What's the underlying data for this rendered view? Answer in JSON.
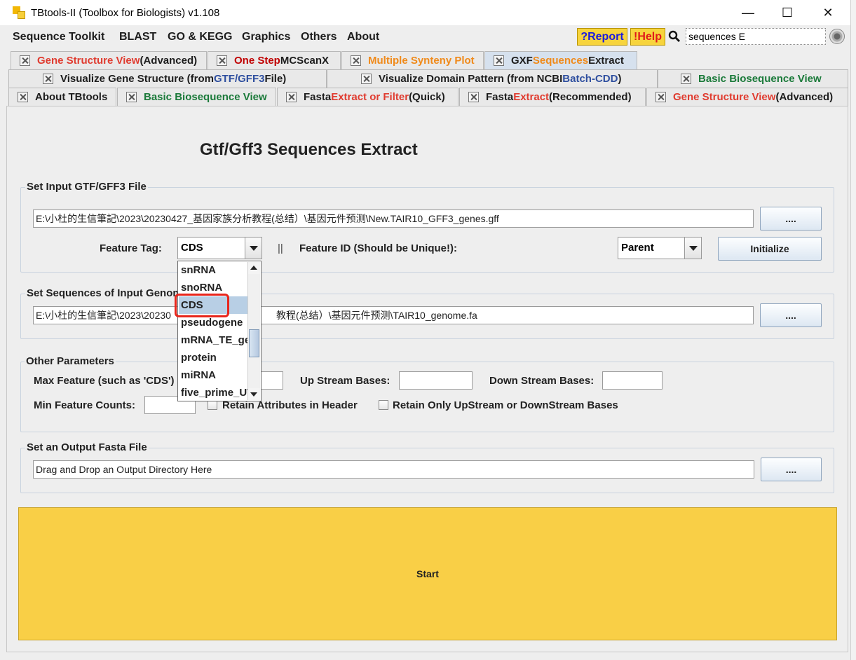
{
  "window": {
    "title": "TBtools-II (Toolbox for Biologists) v1.108",
    "controls": {
      "minimize": "—",
      "maximize": "☐",
      "close": "✕"
    }
  },
  "menu": {
    "items": [
      "Sequence Toolkit",
      "BLAST",
      "GO & KEGG",
      "Graphics",
      "Others",
      "About"
    ],
    "report": "?Report",
    "help": "!Help",
    "search_value": "sequences E"
  },
  "tabs": {
    "row1": [
      {
        "parts": [
          {
            "t": "Gene Structure View",
            "c": "red"
          },
          {
            "t": " (Advanced)",
            "c": "black"
          }
        ]
      },
      {
        "parts": [
          {
            "t": "One Step ",
            "c": "dred"
          },
          {
            "t": "MCScanX",
            "c": "black"
          }
        ]
      },
      {
        "parts": [
          {
            "t": "Multiple Synteny Plot",
            "c": "orange"
          }
        ]
      },
      {
        "parts": [
          {
            "t": "GXF ",
            "c": "black"
          },
          {
            "t": "Sequences",
            "c": "orange"
          },
          {
            "t": " Extract",
            "c": "black"
          }
        ]
      }
    ],
    "row2": [
      {
        "parts": [
          {
            "t": "Visualize Gene Structure (from ",
            "c": "black"
          },
          {
            "t": "GTF/GFF3",
            "c": "blue"
          },
          {
            "t": " File)",
            "c": "black"
          }
        ]
      },
      {
        "parts": [
          {
            "t": "Visualize Domain Pattern (from NCBI ",
            "c": "black"
          },
          {
            "t": "Batch-CDD",
            "c": "blue"
          },
          {
            "t": ")",
            "c": "black"
          }
        ]
      },
      {
        "parts": [
          {
            "t": "Basic Biosequence View",
            "c": "green"
          }
        ]
      }
    ],
    "row3": [
      {
        "parts": [
          {
            "t": "About TBtools",
            "c": "black"
          }
        ]
      },
      {
        "parts": [
          {
            "t": "Basic Biosequence View",
            "c": "green"
          }
        ]
      },
      {
        "parts": [
          {
            "t": "Fasta ",
            "c": "black"
          },
          {
            "t": "Extract or Filter",
            "c": "red"
          },
          {
            "t": " (Quick)",
            "c": "black"
          }
        ]
      },
      {
        "parts": [
          {
            "t": "Fasta ",
            "c": "black"
          },
          {
            "t": "Extract",
            "c": "red"
          },
          {
            "t": " (Recommended)",
            "c": "black"
          }
        ]
      },
      {
        "parts": [
          {
            "t": "Gene Structure View",
            "c": "red"
          },
          {
            "t": " (Advanced)",
            "c": "black"
          }
        ]
      }
    ]
  },
  "main": {
    "title": "Gtf/Gff3 Sequences Extract",
    "gff_group": {
      "label": "Set Input GTF/GFF3 File",
      "path": "E:\\小杜的生信筆記\\2023\\20230427_基因家族分析教程(总结）\\基因元件预测\\New.TAIR10_GFF3_genes.gff",
      "browse": "....",
      "feature_tag_label": "Feature Tag:",
      "feature_tag_value": "CDS",
      "separator": "||",
      "feature_id_label": "Feature ID (Should be Unique!):",
      "feature_id_value": "Parent",
      "initialize": "Initialize"
    },
    "genome_group": {
      "label": "Set Sequences of Input Genom",
      "path_left": "E:\\小杜的生信筆記\\2023\\20230",
      "path_right": "教程(总结）\\基因元件预测\\TAIR10_genome.fa",
      "browse": "...."
    },
    "other_group": {
      "label": "Other Parameters",
      "max_feature_label": "Max Feature (such as 'CDS')",
      "upstream_label": "Up Stream Bases:",
      "downstream_label": "Down Stream Bases:",
      "min_feature_label": "Min Feature Counts:",
      "retain_attr_label": "Retain Attributes in Header",
      "retain_only_label": "Retain Only UpStream or DownStream Bases"
    },
    "output_group": {
      "label": "Set an Output Fasta File",
      "placeholder": "Drag and Drop an Output Directory Here",
      "browse": "...."
    },
    "start": "Start",
    "dropdown_options": [
      "snRNA",
      "snoRNA",
      "CDS",
      "pseudogene",
      "mRNA_TE_gene",
      "protein",
      "miRNA",
      "five_prime_UTR"
    ],
    "dropdown_selected": "CDS"
  },
  "colors": {
    "start_bg": "#f9cf46",
    "highlight": "#e8261c",
    "selected_tab": "#d6e1ee"
  }
}
